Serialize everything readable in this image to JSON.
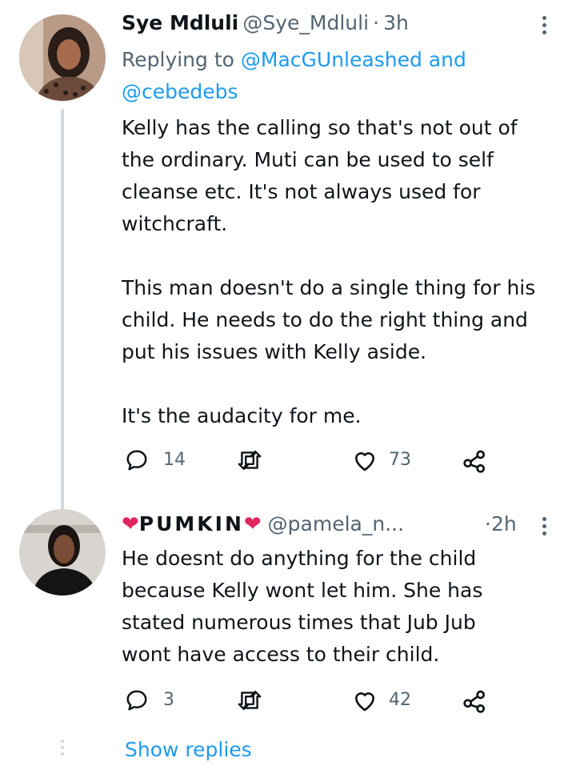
{
  "tweet1": {
    "display_name": "Sye Mdluli",
    "handle": "@Sye_Mdluli",
    "separator": "·",
    "time": "3h",
    "replying_prefix": "Replying to",
    "replying_user1": "@MacGUnleashed",
    "replying_and": "and",
    "replying_user2": "@cebedebs",
    "body": "Kelly has the calling so that's not out of\nthe ordinary. Muti can be used to self\ncleanse etc. It's not always used for\nwitchcraft.\n\nThis man doesn't do a single thing for his\nchild. He needs to do the right thing and\nput his issues with Kelly aside.\n\nIt's the audacity for me.",
    "replies": "14",
    "likes": "73"
  },
  "tweet2": {
    "display_name": "PUMKIN",
    "handle": "@pamela_n...",
    "separator": "·",
    "time": "2h",
    "body": "He doesnt do anything for the child\nbecause Kelly wont let him. She has\nstated numerous times that Jub Jub\nwont have access to their child.",
    "replies": "3",
    "likes": "42"
  },
  "show_replies_label": "Show replies",
  "colors": {
    "accent": "#1d9bf0",
    "heart": "#e0245e",
    "muted": "#536471"
  }
}
